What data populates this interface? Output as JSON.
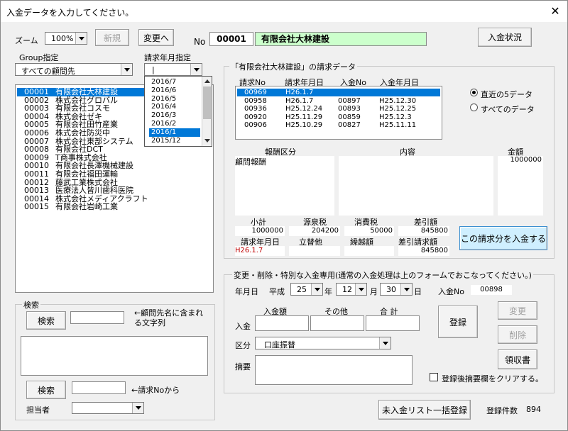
{
  "window": {
    "title": "入金データを入力してください。",
    "close": "✕"
  },
  "toolbar": {
    "zoom_label": "ズーム",
    "zoom_value": "100%",
    "new_button": "新規",
    "change_button": "変更へ",
    "no_label": "No",
    "client_no": "00001",
    "client_name": "有限会社大林建設",
    "status_button": "入金状況"
  },
  "filters": {
    "group_label": "Group指定",
    "group_value": "すべての顧問先",
    "month_label": "請求年月指定",
    "month_value": "|",
    "month_options": [
      "2016/7",
      "2016/6",
      "2016/5",
      "2016/4",
      "2016/3",
      "2016/2",
      "2016/1",
      "2015/12"
    ],
    "month_selected": "2016/1"
  },
  "clients": [
    {
      "code": "00001",
      "name": "有限会社大林建設"
    },
    {
      "code": "00002",
      "name": "株式会社グロバル"
    },
    {
      "code": "00003",
      "name": "有限会社コスモ"
    },
    {
      "code": "00004",
      "name": "株式会社ゼキ"
    },
    {
      "code": "00005",
      "name": "有限会社田竹産業"
    },
    {
      "code": "00006",
      "name": "株式会社防災中"
    },
    {
      "code": "00007",
      "name": "株式会社東部システム"
    },
    {
      "code": "00008",
      "name": "有限会社DCT"
    },
    {
      "code": "00009",
      "name": "T商事株式会社"
    },
    {
      "code": "00010",
      "name": "有限会社長澤機械建設"
    },
    {
      "code": "00011",
      "name": "有限会社福田運輸"
    },
    {
      "code": "00012",
      "name": "藤武工業株式会社"
    },
    {
      "code": "00013",
      "name": "医療法人皆川歯科医院"
    },
    {
      "code": "00014",
      "name": "株式会社メディアクラフト"
    },
    {
      "code": "00015",
      "name": "有限会社岩崎工業"
    }
  ],
  "search": {
    "group_title": "検索",
    "button1": "検索",
    "hint1": "←顧問先名に含まれる文字列",
    "button2": "検索",
    "hint2": "←請求Noから",
    "staff_label": "担当者"
  },
  "invoice": {
    "group_title": "「有限会社大林建設」の請求データ",
    "headers": [
      "請求No",
      "請求年月日",
      "入金No",
      "入金年月日"
    ],
    "rows": [
      {
        "inv_no": "00969",
        "inv_date": "H26.1.7",
        "pay_no": "",
        "pay_date": ""
      },
      {
        "inv_no": "00958",
        "inv_date": "H26.1.7",
        "pay_no": "00897",
        "pay_date": "H25.12.30"
      },
      {
        "inv_no": "00936",
        "inv_date": "H25.12.24",
        "pay_no": "00893",
        "pay_date": "H25.12.25"
      },
      {
        "inv_no": "00920",
        "inv_date": "H25.11.29",
        "pay_no": "00859",
        "pay_date": "H25.12.3"
      },
      {
        "inv_no": "00906",
        "inv_date": "H25.10.29",
        "pay_no": "00827",
        "pay_date": "H25.11.11"
      }
    ],
    "radio_recent": "直近の5データ",
    "radio_all": "すべてのデータ",
    "col_category": "報酬区分",
    "col_content": "内容",
    "col_amount": "金額",
    "category_value": "顧問報酬",
    "amount_value": "1000000",
    "subtotal_label": "小計",
    "subtotal_value": "1000000",
    "withholding_label": "源泉税",
    "withholding_value": "204200",
    "tax_label": "消費税",
    "tax_value": "50000",
    "net_label": "差引額",
    "net_value": "845800",
    "date_label": "請求年月日",
    "date_value": "H26.1.7",
    "adjust_label": "立替他",
    "carry_label": "繰越額",
    "net_claim_label": "差引請求額",
    "net_claim_value": "845800",
    "pay_button": "この請求分を入金する"
  },
  "special": {
    "group_title": "変更・削除・特別な入金専用(通常の入金処理は上のフォームでおこなってください。)",
    "date_label": "年月日",
    "era": "平成",
    "year": "25",
    "year_unit": "年",
    "month": "12",
    "month_unit": "月",
    "day": "30",
    "day_unit": "日",
    "payno_label": "入金No",
    "payno_value": "00898",
    "amount_header": "入金額",
    "other_header": "その他",
    "total_header": "合 計",
    "row_label": "入金",
    "category_label": "区分",
    "category_value": "口座振替",
    "memo_label": "摘要",
    "register_button": "登録",
    "change_button": "変更",
    "delete_button": "削除",
    "receipt_button": "領収書",
    "clear_checkbox": "登録後摘要欄をクリアする。"
  },
  "footer": {
    "bulk_button": "未入金リスト一括登録",
    "count_label": "登録件数",
    "count_value": "894"
  }
}
